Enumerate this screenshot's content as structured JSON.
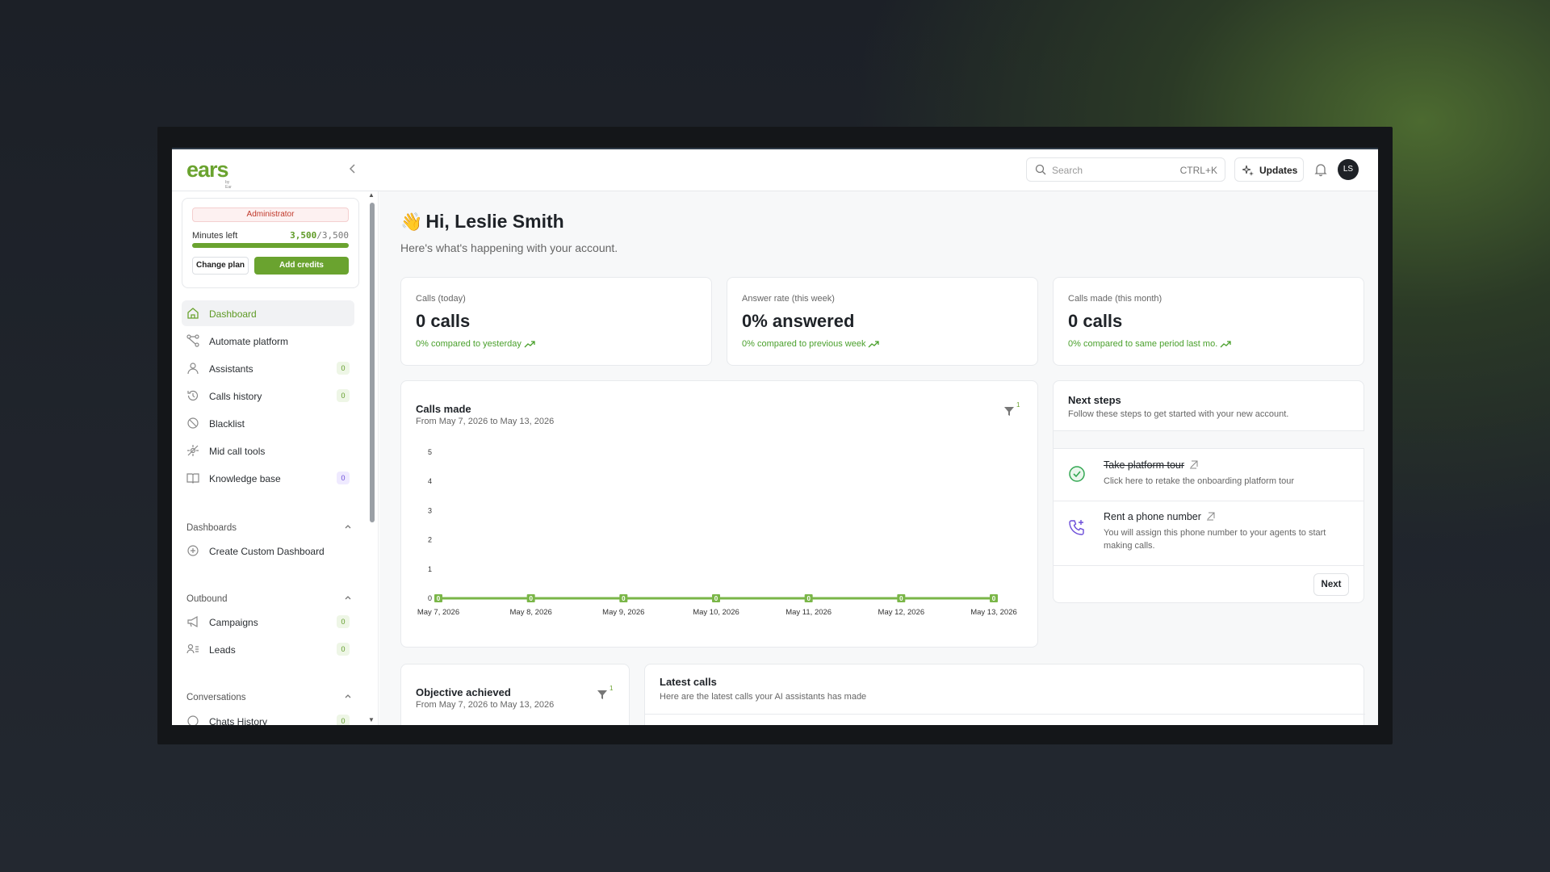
{
  "app": {
    "logo": "ears",
    "logo_sub": "by Ear",
    "search_placeholder": "Search",
    "search_shortcut": "CTRL+K",
    "updates_label": "Updates",
    "avatar_initials": "LS",
    "brand_color": "#6aa32f"
  },
  "plan": {
    "role": "Administrator",
    "minutes_label": "Minutes left",
    "minutes_used": "3,500",
    "minutes_total": "/3,500",
    "minutes_fraction": 1.0,
    "change_plan": "Change plan",
    "add_credits": "Add credits"
  },
  "sidebar": {
    "items": [
      {
        "label": "Dashboard",
        "icon": "home-icon",
        "active": true
      },
      {
        "label": "Automate platform",
        "icon": "workflow-icon"
      },
      {
        "label": "Assistants",
        "icon": "user-icon",
        "badge": "0"
      },
      {
        "label": "Calls history",
        "icon": "history-icon",
        "badge": "0"
      },
      {
        "label": "Blacklist",
        "icon": "block-icon"
      },
      {
        "label": "Mid call tools",
        "icon": "tools-icon"
      },
      {
        "label": "Knowledge base",
        "icon": "book-icon",
        "badge": "0"
      }
    ],
    "sections": {
      "dashboards": "Dashboards",
      "create_dashboard": "Create Custom Dashboard",
      "outbound": "Outbound",
      "campaigns": "Campaigns",
      "campaigns_badge": "0",
      "leads": "Leads",
      "leads_badge": "0",
      "conversations": "Conversations",
      "chats_history": "Chats History",
      "chats_badge": "0"
    }
  },
  "main": {
    "greeting": "Hi, Leslie Smith",
    "wave": "👋",
    "subtitle": "Here's what's happening with your account.",
    "stats": [
      {
        "title": "Calls (today)",
        "value": "0 calls",
        "change": "0% compared to yesterday"
      },
      {
        "title": "Answer rate (this week)",
        "value": "0% answered",
        "change": "0% compared to previous week"
      },
      {
        "title": "Calls made (this month)",
        "value": "0 calls",
        "change": "0% compared to same period last mo."
      }
    ],
    "calls_chart": {
      "title": "Calls made",
      "subtitle": "From May 7, 2026 to May 13, 2026",
      "filter_count": "1"
    },
    "next_steps": {
      "title": "Next steps",
      "subtitle": "Follow these steps to get started with your new account.",
      "steps": [
        {
          "title": "Take platform tour",
          "desc": "Click here to retake the onboarding platform tour"
        },
        {
          "title": "Rent a phone number",
          "desc": "You will assign this phone number to your agents to start making calls."
        }
      ],
      "next_label": "Next"
    },
    "objective": {
      "title": "Objective achieved",
      "subtitle": "From May 7, 2026 to May 13, 2026",
      "filter_count": "1"
    },
    "latest_calls": {
      "title": "Latest calls",
      "subtitle": "Here are the latest calls your AI assistants has made"
    }
  },
  "chart_data": {
    "type": "line",
    "title": "Calls made",
    "categories": [
      "May 7, 2026",
      "May 8, 2026",
      "May 9, 2026",
      "May 10, 2026",
      "May 11, 2026",
      "May 12, 2026",
      "May 13, 2026"
    ],
    "values": [
      0,
      0,
      0,
      0,
      0,
      0,
      0
    ],
    "yticks": [
      "0",
      "1",
      "2",
      "3",
      "4",
      "5"
    ],
    "ylim": [
      0,
      5
    ],
    "color": "#7ab648",
    "grid": false,
    "data_labels": true
  }
}
